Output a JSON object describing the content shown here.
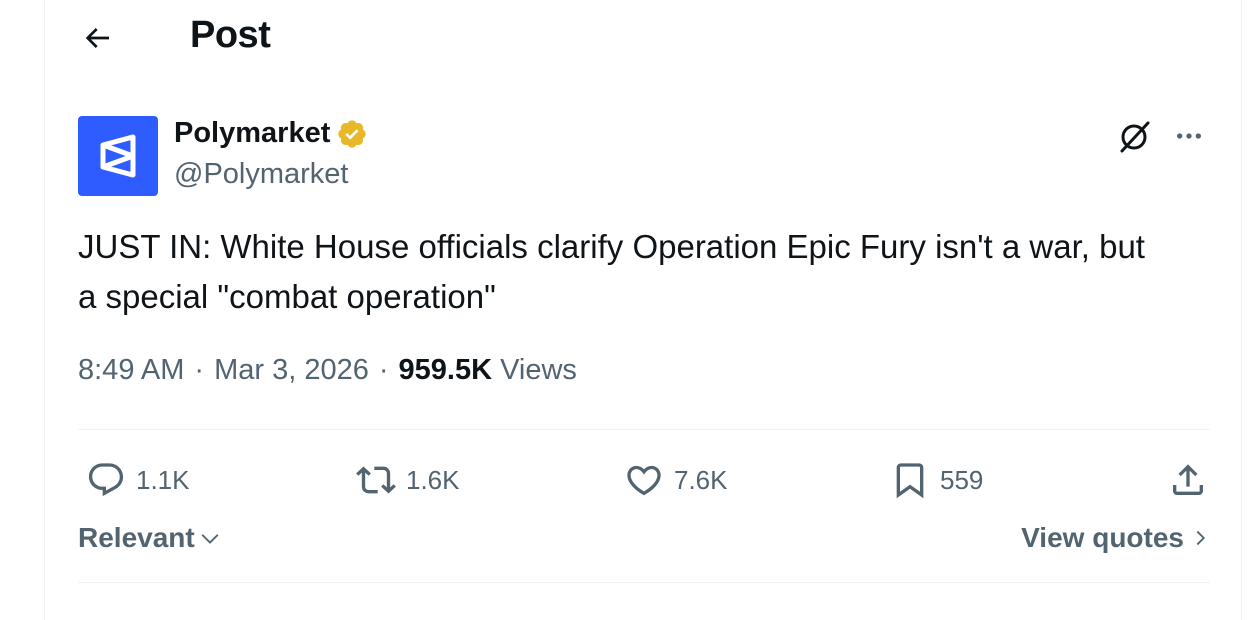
{
  "header": {
    "title": "Post",
    "back_icon": "arrow-left-icon"
  },
  "author": {
    "display_name": "Polymarket",
    "handle": "@Polymarket",
    "verified_badge_color": "#e8b829",
    "avatar_color": "#2e5cff"
  },
  "post": {
    "text_line1": "JUST IN: White House officials clarify Operation Epic Fury isn't a war, but",
    "text_line2": "a special \"combat operation\"",
    "time": "8:49 AM",
    "date": "Mar 3, 2026",
    "views_count": "959.5K",
    "views_label": "Views",
    "separator": "·"
  },
  "actions": {
    "replies": "1.1K",
    "reposts": "1.6K",
    "likes": "7.6K",
    "bookmarks": "559"
  },
  "footer": {
    "sort_label": "Relevant",
    "view_quotes_label": "View quotes"
  }
}
